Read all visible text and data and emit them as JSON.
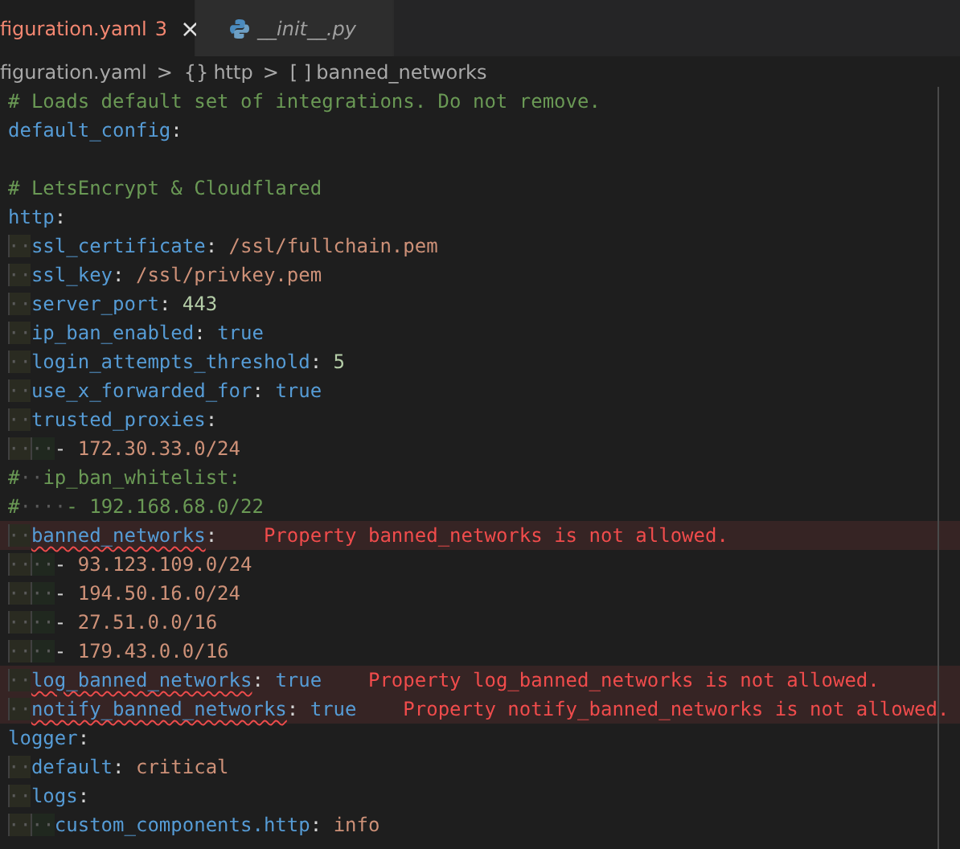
{
  "tabs": [
    {
      "kind": "yaml",
      "label": "figuration.yaml",
      "problems": "3",
      "close": "×",
      "selected": true,
      "preview": false
    },
    {
      "kind": "python",
      "label": "__init__.py",
      "selected": false,
      "preview": true
    }
  ],
  "breadcrumb": [
    {
      "label": "figuration.yaml"
    },
    {
      "symbol": "{}",
      "label": "http"
    },
    {
      "symbol": "[ ]",
      "label": "banned_networks"
    }
  ],
  "separator": ">",
  "lines": [
    {
      "tokens": [
        {
          "kind": "comment",
          "text": "# Loads default set of integrations. Do not remove."
        }
      ]
    },
    {
      "tokens": [
        {
          "kind": "key",
          "text": "default_config"
        },
        {
          "kind": "punct",
          "text": ":"
        }
      ]
    },
    {
      "kind": "blank"
    },
    {
      "tokens": [
        {
          "kind": "comment",
          "text": "# LetsEncrypt & Cloudflared"
        }
      ]
    },
    {
      "tokens": [
        {
          "kind": "key",
          "text": "http"
        },
        {
          "kind": "punct",
          "text": ":"
        }
      ]
    },
    {
      "indent": [
        "··"
      ],
      "tokens": [
        {
          "kind": "key",
          "text": "ssl_certificate"
        },
        {
          "kind": "punct",
          "text": ": "
        },
        {
          "kind": "string",
          "text": "/ssl/fullchain.pem"
        }
      ]
    },
    {
      "indent": [
        "··"
      ],
      "tokens": [
        {
          "kind": "key",
          "text": "ssl_key"
        },
        {
          "kind": "punct",
          "text": ": "
        },
        {
          "kind": "string",
          "text": "/ssl/privkey.pem"
        }
      ]
    },
    {
      "indent": [
        "··"
      ],
      "tokens": [
        {
          "kind": "key",
          "text": "server_port"
        },
        {
          "kind": "punct",
          "text": ": "
        },
        {
          "kind": "number",
          "text": "443"
        }
      ]
    },
    {
      "indent": [
        "··"
      ],
      "tokens": [
        {
          "kind": "key",
          "text": "ip_ban_enabled"
        },
        {
          "kind": "punct",
          "text": ": "
        },
        {
          "kind": "bool",
          "text": "true"
        }
      ]
    },
    {
      "indent": [
        "··"
      ],
      "tokens": [
        {
          "kind": "key",
          "text": "login_attempts_threshold"
        },
        {
          "kind": "punct",
          "text": ": "
        },
        {
          "kind": "number",
          "text": "5"
        }
      ]
    },
    {
      "indent": [
        "··"
      ],
      "tokens": [
        {
          "kind": "key",
          "text": "use_x_forwarded_for"
        },
        {
          "kind": "punct",
          "text": ": "
        },
        {
          "kind": "bool",
          "text": "true"
        }
      ]
    },
    {
      "indent": [
        "··"
      ],
      "tokens": [
        {
          "kind": "key",
          "text": "trusted_proxies"
        },
        {
          "kind": "punct",
          "text": ":"
        }
      ]
    },
    {
      "indent": [
        "··",
        "··"
      ],
      "tokens": [
        {
          "kind": "punct",
          "text": "- "
        },
        {
          "kind": "string",
          "text": "172.30.33.0/24"
        }
      ]
    },
    {
      "tokens": [
        {
          "kind": "comment",
          "text": "#"
        },
        {
          "kind": "space",
          "text": "··"
        },
        {
          "kind": "comment",
          "text": "ip_ban_whitelist:"
        }
      ]
    },
    {
      "tokens": [
        {
          "kind": "comment",
          "text": "#"
        },
        {
          "kind": "space",
          "text": "····"
        },
        {
          "kind": "comment",
          "text": "- 192.168.68.0/22"
        }
      ]
    },
    {
      "indent": [
        "··"
      ],
      "tokens": [
        {
          "kind": "key",
          "text": "banned_networks",
          "squiggle": true
        },
        {
          "kind": "punct",
          "text": ":"
        }
      ],
      "message": "Property banned_networks is not allowed."
    },
    {
      "indent": [
        "··",
        "··"
      ],
      "tokens": [
        {
          "kind": "punct",
          "text": "- "
        },
        {
          "kind": "string",
          "text": "93.123.109.0/24"
        }
      ]
    },
    {
      "indent": [
        "··",
        "··"
      ],
      "tokens": [
        {
          "kind": "punct",
          "text": "- "
        },
        {
          "kind": "string",
          "text": "194.50.16.0/24"
        }
      ]
    },
    {
      "indent": [
        "··",
        "··"
      ],
      "tokens": [
        {
          "kind": "punct",
          "text": "- "
        },
        {
          "kind": "string",
          "text": "27.51.0.0/16"
        }
      ]
    },
    {
      "indent": [
        "··",
        "··"
      ],
      "tokens": [
        {
          "kind": "punct",
          "text": "- "
        },
        {
          "kind": "string",
          "text": "179.43.0.0/16"
        }
      ]
    },
    {
      "indent": [
        "··"
      ],
      "tokens": [
        {
          "kind": "key",
          "text": "log_banned_networks",
          "squiggle": true
        },
        {
          "kind": "punct",
          "text": ": "
        },
        {
          "kind": "bool",
          "text": "true"
        }
      ],
      "message": "Property log_banned_networks is not allowed."
    },
    {
      "indent": [
        "··"
      ],
      "tokens": [
        {
          "kind": "key",
          "text": "notify_banned_networks",
          "squiggle": true
        },
        {
          "kind": "punct",
          "text": ": "
        },
        {
          "kind": "bool",
          "text": "true"
        }
      ],
      "message": "Property notify_banned_networks is not allowed."
    },
    {
      "tokens": [
        {
          "kind": "key",
          "text": "logger"
        },
        {
          "kind": "punct",
          "text": ":"
        }
      ]
    },
    {
      "indent": [
        "··"
      ],
      "tokens": [
        {
          "kind": "key",
          "text": "default"
        },
        {
          "kind": "punct",
          "text": ": "
        },
        {
          "kind": "string",
          "text": "critical"
        }
      ]
    },
    {
      "indent": [
        "··"
      ],
      "tokens": [
        {
          "kind": "key",
          "text": "logs"
        },
        {
          "kind": "punct",
          "text": ":"
        }
      ]
    },
    {
      "indent": [
        "··",
        "··"
      ],
      "tokens": [
        {
          "kind": "key",
          "text": "custom_components.http"
        },
        {
          "kind": "punct",
          "text": ": "
        },
        {
          "kind": "string",
          "text": "info"
        }
      ]
    }
  ]
}
